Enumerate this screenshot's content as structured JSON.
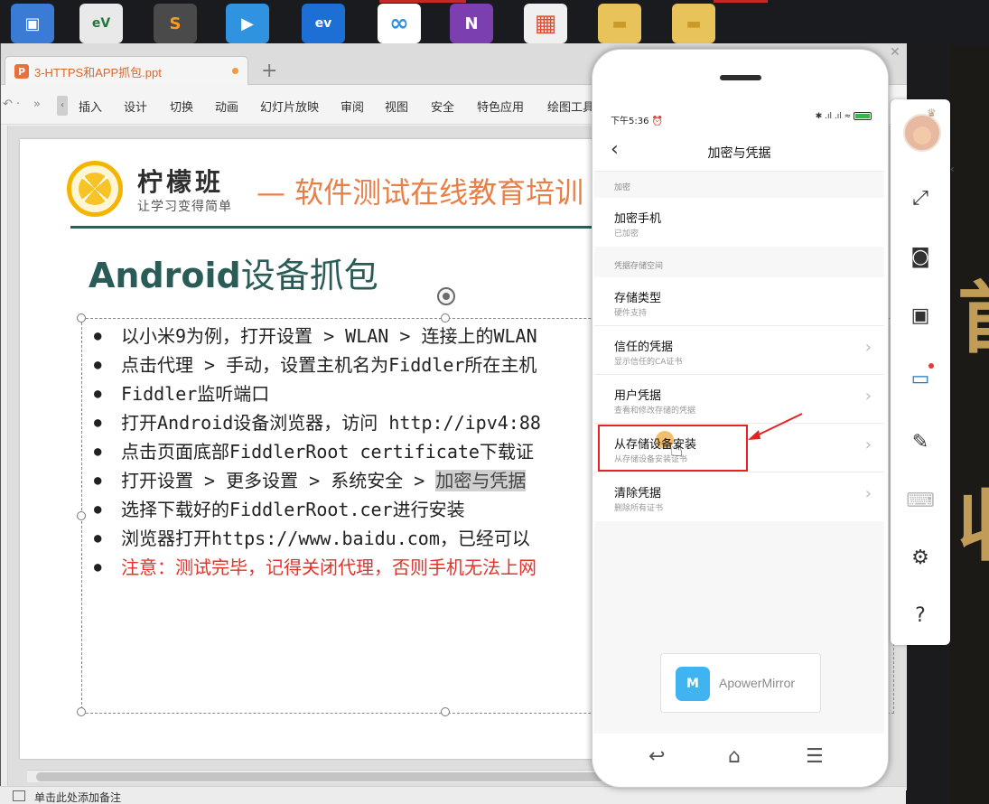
{
  "desktop": {
    "icons": [
      {
        "name": "computer-icon",
        "color": "#3a7bd5",
        "glyph": "▣"
      },
      {
        "name": "ev-recorder-icon",
        "color": "#e9e9e9",
        "glyph": "eV"
      },
      {
        "name": "sublime-icon",
        "color": "#4a4a4a",
        "glyph": "S"
      },
      {
        "name": "video-player-icon",
        "color": "#2f93e0",
        "glyph": "▶"
      },
      {
        "name": "ev-player-icon",
        "color": "#1d6fd6",
        "glyph": "ev"
      },
      {
        "name": "baidu-netdisk-icon",
        "color": "#ffffff",
        "glyph": "∞"
      },
      {
        "name": "onenote-icon",
        "color": "#7b3fb0",
        "glyph": "N"
      },
      {
        "name": "office-icon",
        "color": "#e04c2f",
        "glyph": "▦"
      },
      {
        "name": "folder-icon",
        "color": "#e8c35a",
        "glyph": "▬"
      },
      {
        "name": "folder-icon-2",
        "color": "#e8c35a",
        "glyph": "▬"
      }
    ]
  },
  "wps": {
    "tab_title": "3-HTTPS和APP抓包.ppt",
    "new_tab": "+",
    "ribbon": [
      "插入",
      "设计",
      "切换",
      "动画",
      "幻灯片放映",
      "审阅",
      "视图",
      "安全",
      "特色应用",
      "绘图工具"
    ],
    "status_text": "单击此处添加备注"
  },
  "slide": {
    "brand": "柠檬班",
    "brand_sub": "让学习变得简单",
    "tagline": "— 软件测试在线教育培训",
    "heading_bold": "Android",
    "heading_rest": "设备抓包",
    "bullets": [
      "以小米9为例，打开设置 > WLAN > 连接上的WLAN",
      "点击代理 > 手动，设置主机名为Fiddler所在主机",
      "Fiddler监听端口",
      "打开Android设备浏览器，访问 http://ipv4:88",
      "点击页面底部FiddlerRoot certificate下载证",
      "打开设置 > 更多设置 > 系统安全 > ",
      "选择下载好的FiddlerRoot.cer进行安装",
      "浏览器打开https://www.baidu.com，已经可以",
      "注意：测试完毕，记得关闭代理，否则手机无法上网"
    ],
    "bullet_highlight": "加密与凭据"
  },
  "phone": {
    "time": "下午5:36 ⏰",
    "status_icons": "✱ .ıl .ıl ≈",
    "title": "加密与凭据",
    "section_encrypt": "加密",
    "section_storage": "凭据存储空间",
    "rows": [
      {
        "title": "加密手机",
        "sub": "已加密"
      },
      {
        "title": "存储类型",
        "sub": "硬件支持"
      },
      {
        "title": "信任的凭据",
        "sub": "显示信任的CA证书"
      },
      {
        "title": "用户凭据",
        "sub": "查看和修改存储的凭据"
      },
      {
        "title": "从存储设备安装",
        "sub": "从存储设备安装证书"
      },
      {
        "title": "清除凭据",
        "sub": "删除所有证书"
      }
    ],
    "apower_brand": "ApowerMirror"
  },
  "toolbar": {
    "items": [
      "fullscreen-icon",
      "camera-icon",
      "video-record-icon",
      "screen-cast-icon",
      "brush-icon",
      "keyboard-icon",
      "settings-icon",
      "help-icon"
    ]
  },
  "colors": {
    "accent_red": "#e52323",
    "brand_teal": "#2a5c57",
    "tagline_orange": "#e77f47",
    "gold": "#c9a35b"
  }
}
